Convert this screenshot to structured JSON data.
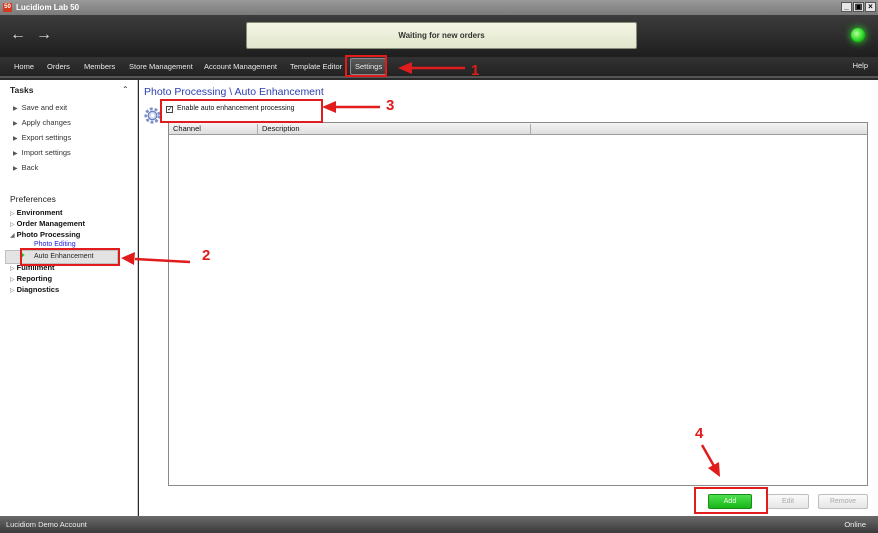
{
  "window": {
    "title": "Lucidiom Lab 50",
    "app_icon": "50"
  },
  "toolbar": {
    "back": "←",
    "forward": "→",
    "status_text": "Waiting for new orders",
    "status_led_color": "#27d822"
  },
  "menu": {
    "items": [
      "Home",
      "Orders",
      "Members",
      "Store Management",
      "Account Management",
      "Template Editor",
      "Settings"
    ],
    "help": "Help"
  },
  "tasks": {
    "title": "Tasks",
    "items": [
      "Save and exit",
      "Apply changes",
      "Export settings",
      "Import settings",
      "Back"
    ]
  },
  "preferences": {
    "title": "Preferences",
    "items": [
      "Environment",
      "Order Management",
      "Photo Processing",
      "Fulfillment",
      "Reporting",
      "Diagnostics"
    ],
    "sub_items": [
      "Photo Editing",
      "Auto Enhancement"
    ]
  },
  "content": {
    "breadcrumb": "Photo Processing \\ Auto Enhancement",
    "checkbox_label": "Enable auto enhancement processing",
    "checkbox_checked": true,
    "columns": [
      "Channel",
      "Description",
      ""
    ],
    "rows": [],
    "buttons": {
      "add": "Add",
      "edit": "Edit",
      "remove": "Remove"
    }
  },
  "statusbar": {
    "account": "Lucidiom Demo Account",
    "connection": "Online"
  },
  "annotations": {
    "labels": [
      "1",
      "2",
      "3",
      "4"
    ],
    "color": "#e01c1c"
  }
}
